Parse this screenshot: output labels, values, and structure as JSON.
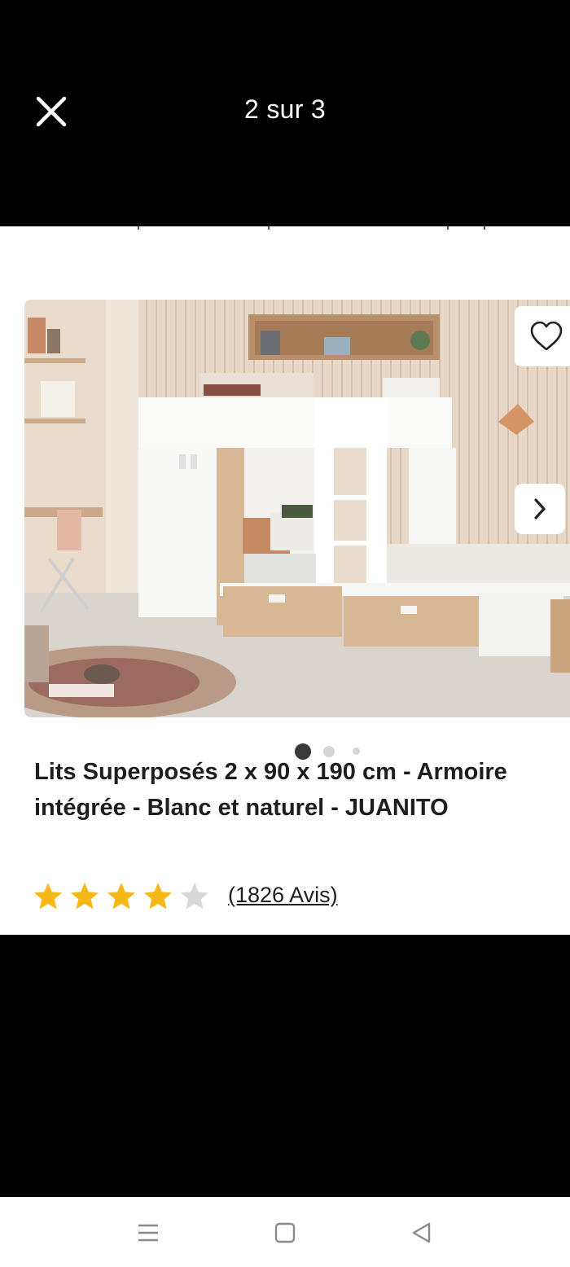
{
  "viewer": {
    "counter": "2 sur 3"
  },
  "product": {
    "title": "Lits Superposés 2 x 90 x 190 cm - Armoire intégrée - Blanc et naturel - JUANITO",
    "rating": 4,
    "rating_max": 5,
    "reviews_label": "(1826 Avis)"
  },
  "carousel": {
    "dots": 3,
    "active_index": 0
  },
  "colors": {
    "star_filled": "#f5b817",
    "star_empty": "#d9d9d9",
    "backdrop": "#000000"
  },
  "icons": {
    "close": "close-icon",
    "favorite": "heart-outline-icon",
    "next": "chevron-right-icon",
    "nav_menu": "menu-icon",
    "nav_home": "home-square-icon",
    "nav_back": "back-triangle-icon"
  }
}
